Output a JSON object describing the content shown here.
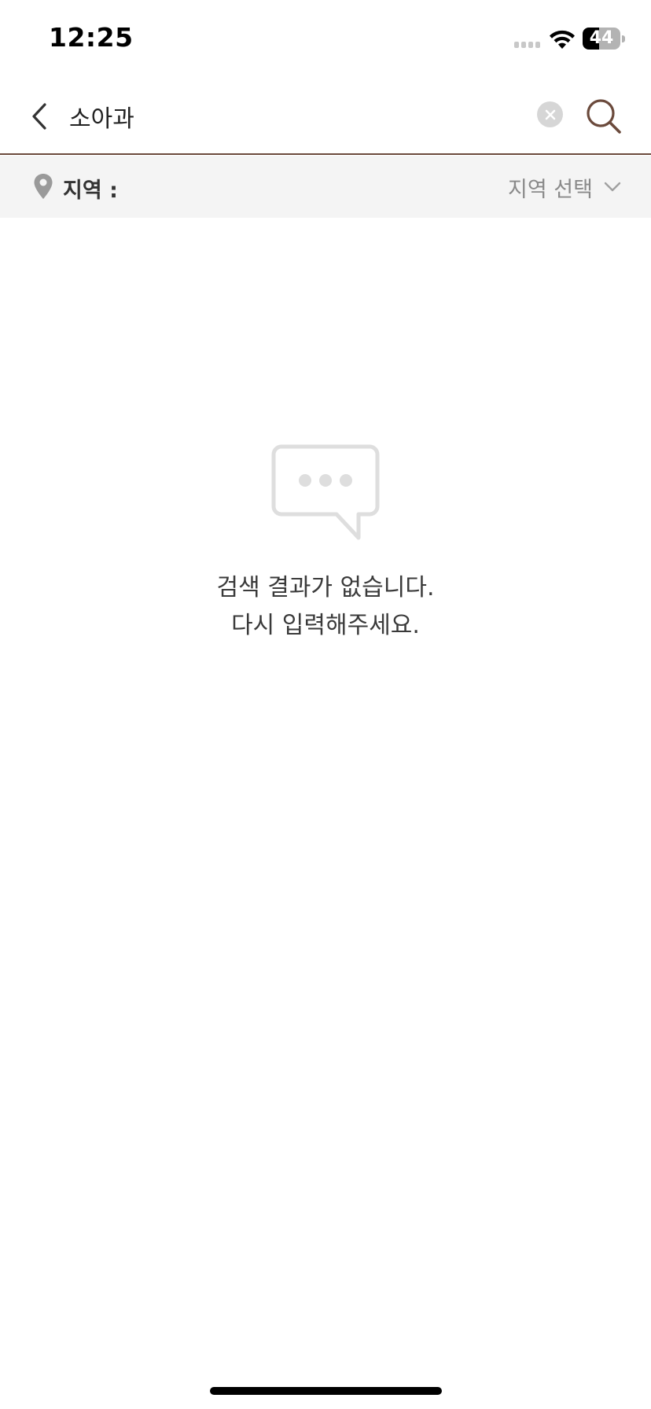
{
  "status_bar": {
    "time": "12:25",
    "battery_level": "44",
    "battery_fraction": 0.44
  },
  "search": {
    "query": "소아과",
    "back_icon": "chevron-left-icon",
    "clear_icon": "clear-circle-icon",
    "search_icon": "magnifier-icon",
    "accent_color": "#6b4a3c"
  },
  "region": {
    "label": "지역 :",
    "select_text": "지역 선택",
    "pin_icon": "location-pin-icon",
    "dropdown_icon": "chevron-down-icon"
  },
  "empty_state": {
    "icon": "speech-bubble-icon",
    "line1": "검색 결과가 없습니다.",
    "line2": "다시 입력해주세요."
  }
}
